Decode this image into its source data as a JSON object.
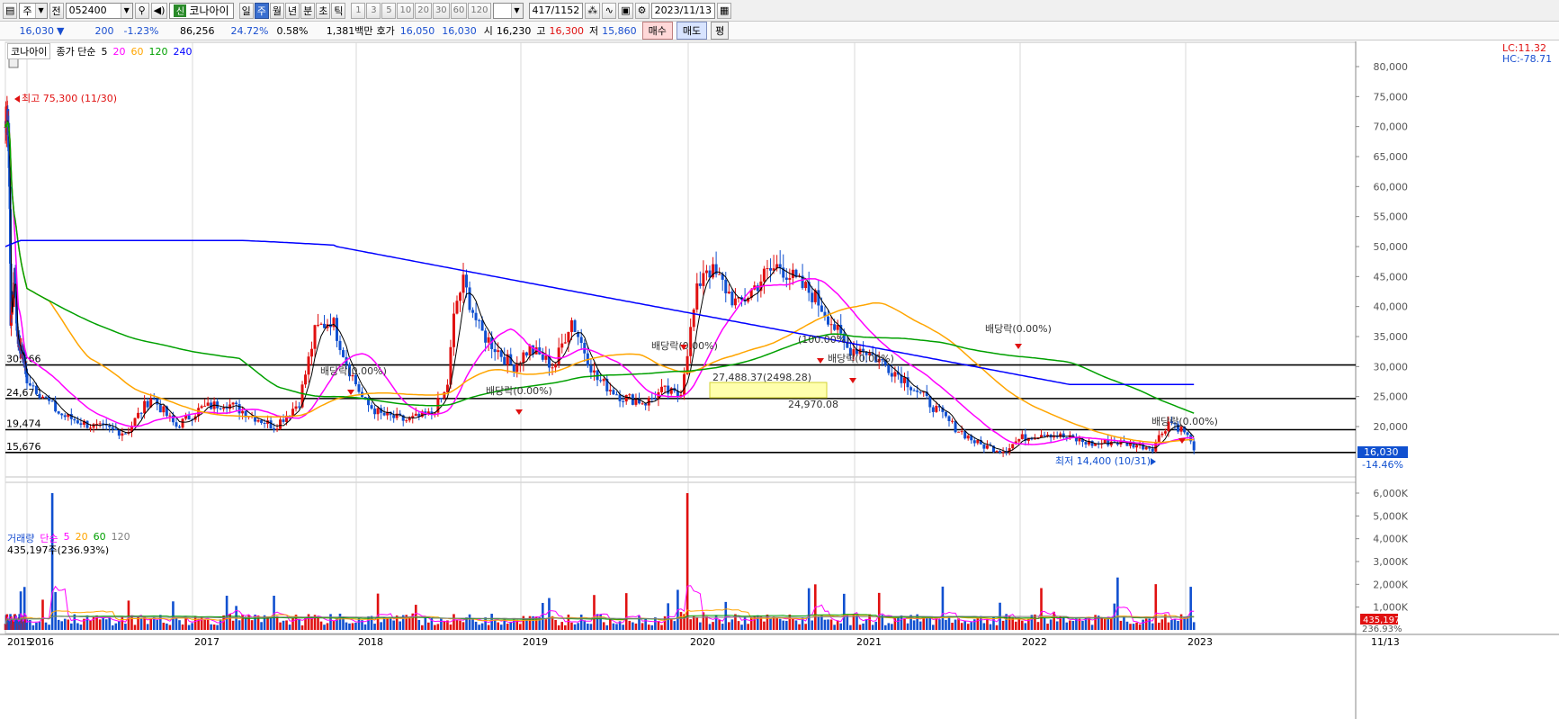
{
  "toolbar": {
    "market": "주",
    "view": "전",
    "code": "052400",
    "stock_badge": "신",
    "stock_name": "코나아이",
    "periods": [
      "일",
      "주",
      "월",
      "년",
      "분",
      "초",
      "틱"
    ],
    "active_period": "주",
    "intervals": [
      "1",
      "3",
      "5",
      "10",
      "20",
      "30",
      "60",
      "120"
    ],
    "count": "417",
    "total": "/1152",
    "date": "2023/11/13"
  },
  "quote": {
    "price": "16,030",
    "change_arrow": "▼",
    "change": "200",
    "change_pct": "-1.23%",
    "volume": "86,256",
    "volume_pct": "24.72%",
    "turnover": "0.58%",
    "amount": "1,381백만",
    "hoga_label": "호가",
    "hoga_ask": "16,050",
    "hoga_bid": "16,030",
    "open_label": "시",
    "open": "16,230",
    "high_label": "고",
    "high": "16,300",
    "low_label": "저",
    "low": "15,860",
    "buy": "매수",
    "sell": "매도",
    "eval": "평"
  },
  "price_legend": {
    "name": "코나아이",
    "desc": "종가 단순",
    "periods": [
      "5",
      "20",
      "60",
      "120",
      "240"
    ],
    "colors": [
      "#000000",
      "#ff00ff",
      "#ffa500",
      "#00a000",
      "#0000ff"
    ]
  },
  "lc_hc": {
    "lc": "LC:11.32",
    "hc": "HC:-78.71"
  },
  "price_axis": [
    "80,000",
    "75,000",
    "70,000",
    "65,000",
    "60,000",
    "55,000",
    "50,000",
    "45,000",
    "40,000",
    "35,000",
    "30,000",
    "25,000",
    "20,000"
  ],
  "hlines": [
    {
      "label": "30,266",
      "value": 30266
    },
    {
      "label": "24,670",
      "value": 24670
    },
    {
      "label": "19,474",
      "value": 19474
    },
    {
      "label": "15,676",
      "value": 15676
    }
  ],
  "annotations": {
    "high": "최고 75,300 (11/30)",
    "low": "최저 14,400 (10/31)",
    "div1": "배당락(0.00%)",
    "div2": "배당락(0.00%)",
    "div3": "배당락(0.00%)",
    "div4": "배당락(0.00%)",
    "div5": "배당락(0.00%)",
    "div6": "배당락(0.00%)",
    "split": "(100.00%)",
    "box_label": "27,488.37(2498.28)",
    "box_low": "24,970.08"
  },
  "current_price_label": "16,030",
  "current_pct_label": "-14.46%",
  "volume_legend": {
    "title": "거래량",
    "desc": "단순",
    "periods": [
      "5",
      "20",
      "60",
      "120"
    ],
    "colors": [
      "#ff00ff",
      "#ffa500",
      "#00a000",
      "#808080"
    ],
    "sub": "435,197주(236.93%)"
  },
  "volume_axis": [
    "6,000K",
    "5,000K",
    "4,000K",
    "3,000K",
    "2,000K",
    "1,000K"
  ],
  "volume_current": "435,197",
  "volume_pct_label": "236.93%",
  "x_axis": [
    "2015",
    "2016",
    "2017",
    "2018",
    "2019",
    "2020",
    "2021",
    "2022",
    "2023",
    "11/13"
  ],
  "chart_data": {
    "type": "candlestick",
    "price_ylim": [
      12000,
      82000
    ],
    "volume_ylim": [
      0,
      6500
    ],
    "years": [
      2015,
      2016,
      2017,
      2018,
      2019,
      2020,
      2021,
      2022,
      2023
    ],
    "close_path": [
      [
        2015.0,
        70000
      ],
      [
        2015.1,
        73000
      ],
      [
        2015.2,
        60000
      ],
      [
        2015.25,
        38000
      ],
      [
        2015.35,
        42000
      ],
      [
        2015.45,
        45000
      ],
      [
        2015.55,
        35000
      ],
      [
        2015.7,
        33000
      ],
      [
        2015.85,
        32000
      ],
      [
        2016.0,
        28000
      ],
      [
        2016.2,
        22000
      ],
      [
        2016.4,
        20000
      ],
      [
        2016.6,
        19000
      ],
      [
        2016.75,
        25000
      ],
      [
        2016.9,
        20000
      ],
      [
        2017.05,
        23000
      ],
      [
        2017.2,
        24000
      ],
      [
        2017.35,
        22000
      ],
      [
        2017.5,
        20000
      ],
      [
        2017.65,
        24000
      ],
      [
        2017.75,
        36000
      ],
      [
        2017.85,
        38000
      ],
      [
        2017.95,
        30000
      ],
      [
        2018.05,
        24000
      ],
      [
        2018.15,
        22000
      ],
      [
        2018.3,
        21000
      ],
      [
        2018.45,
        22000
      ],
      [
        2018.55,
        26000
      ],
      [
        2018.6,
        40000
      ],
      [
        2018.65,
        44000
      ],
      [
        2018.75,
        36000
      ],
      [
        2018.85,
        33000
      ],
      [
        2018.95,
        30000
      ],
      [
        2019.05,
        33000
      ],
      [
        2019.2,
        30000
      ],
      [
        2019.3,
        38000
      ],
      [
        2019.45,
        28000
      ],
      [
        2019.6,
        25000
      ],
      [
        2019.75,
        24000
      ],
      [
        2019.85,
        26000
      ],
      [
        2019.95,
        25000
      ],
      [
        2020.05,
        42000
      ],
      [
        2020.1,
        47000
      ],
      [
        2020.2,
        44000
      ],
      [
        2020.3,
        40000
      ],
      [
        2020.45,
        45000
      ],
      [
        2020.55,
        47000
      ],
      [
        2020.65,
        44000
      ],
      [
        2020.75,
        42000
      ],
      [
        2020.85,
        38000
      ],
      [
        2020.95,
        33000
      ],
      [
        2021.05,
        33000
      ],
      [
        2021.2,
        30000
      ],
      [
        2021.3,
        28000
      ],
      [
        2021.45,
        24000
      ],
      [
        2021.6,
        20000
      ],
      [
        2021.75,
        17000
      ],
      [
        2021.9,
        16000
      ],
      [
        2022.0,
        18000
      ],
      [
        2022.15,
        19000
      ],
      [
        2022.3,
        18000
      ],
      [
        2022.45,
        17000
      ],
      [
        2022.55,
        17500
      ],
      [
        2022.7,
        17000
      ],
      [
        2022.8,
        16500
      ],
      [
        2022.9,
        21000
      ],
      [
        2023.0,
        19000
      ],
      [
        2023.05,
        16030
      ]
    ]
  }
}
